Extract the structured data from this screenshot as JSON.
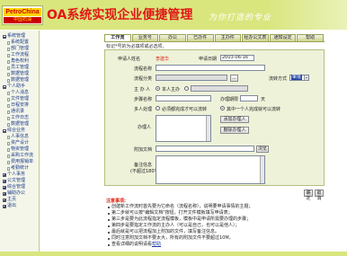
{
  "header": {
    "logo_top": "PetroChina",
    "logo_bottom": "中国石油",
    "title": "OA系统实现企业便捷管理",
    "slogan": "为你打造的专业"
  },
  "sidebar": {
    "items": [
      {
        "label": "系统管理",
        "level": 1,
        "icon": "minus-icon"
      },
      {
        "label": "系统配置",
        "level": 2,
        "icon": "doc-icon"
      },
      {
        "label": "部门管理",
        "level": 2,
        "icon": "doc-icon"
      },
      {
        "label": "工作流程",
        "level": 2,
        "icon": "doc-icon"
      },
      {
        "label": "角色权利",
        "level": 2,
        "icon": "doc-icon"
      },
      {
        "label": "员工管理",
        "level": 2,
        "icon": "doc-icon"
      },
      {
        "label": "数据管理",
        "level": 2,
        "icon": "doc-icon"
      },
      {
        "label": "数据管理",
        "level": 2,
        "icon": "doc-icon"
      },
      {
        "label": "个人助手",
        "level": 1,
        "icon": "minus-icon"
      },
      {
        "label": "个人消息",
        "level": 2,
        "icon": "doc-icon"
      },
      {
        "label": "文件管理",
        "level": 2,
        "icon": "doc-icon"
      },
      {
        "label": "日程安排",
        "level": 2,
        "icon": "doc-icon"
      },
      {
        "label": "通讯录",
        "level": 2,
        "icon": "doc-icon"
      },
      {
        "label": "工作日志",
        "level": 2,
        "icon": "doc-icon"
      },
      {
        "label": "数据管理",
        "level": 2,
        "icon": "doc-icon"
      },
      {
        "label": "综合业务",
        "level": 1,
        "icon": "minus-icon"
      },
      {
        "label": "人事信息",
        "level": 2,
        "icon": "doc-icon"
      },
      {
        "label": "资产设计",
        "level": 2,
        "icon": "doc-icon"
      },
      {
        "label": "物资管理",
        "level": 2,
        "icon": "doc-icon"
      },
      {
        "label": "采购工作流",
        "level": 2,
        "icon": "doc-icon"
      },
      {
        "label": "费用报销单",
        "level": 2,
        "icon": "doc-icon"
      },
      {
        "label": "考勤统计",
        "level": 2,
        "icon": "doc-icon"
      },
      {
        "label": "个人事务",
        "level": 1,
        "icon": "plus-icon"
      },
      {
        "label": "公文管理",
        "level": 1,
        "icon": "plus-icon"
      },
      {
        "label": "综合管理",
        "level": 1,
        "icon": "plus-icon"
      },
      {
        "label": "辅助办公",
        "level": 1,
        "icon": "plus-icon"
      },
      {
        "label": "主页",
        "level": 1,
        "icon": "plus-icon"
      },
      {
        "label": "退出",
        "level": 1,
        "icon": "plus-icon"
      }
    ]
  },
  "tabs": [
    "工作流",
    "业务号",
    "办公",
    "已办件",
    "主办件",
    "经办公文表",
    "通知设定",
    "帮助"
  ],
  "notice": "标记*号的为必填项或必选项。",
  "form": {
    "applicant_label": "申请人姓名",
    "applicant_value": "李建华",
    "date_label": "申请日期",
    "date_value": "2003-06-16",
    "flow_name_label": "流程名称",
    "flow_name_value": "",
    "flow_type_label": "流程分类",
    "flow_type_value": "",
    "flow_type_btn": "...",
    "flow_mode_label": "流转方式",
    "flow_mode_value": "审批",
    "host_label": "主 办 人",
    "host_option1": "本人主办",
    "host_option2": "",
    "step_label": "步骤名称",
    "step_value": "",
    "handle_deadline_label": "办理期限",
    "handle_deadline_unit": "天",
    "multi_label": "多人处理",
    "multi_option1": "必须都完成才可以流转",
    "multi_option2": "其中一个人完成就可以流转",
    "handler_label": "办理人",
    "add_handler_btn": "添加办理人",
    "remove_handler_btn": "删除办理人",
    "attachment_label": "附加文档",
    "attachment_btn": "浏览",
    "note_label": "备注信息",
    "note_hint": "(不超过180字)",
    "submit_btn": "确定",
    "reset_btn": "取消"
  },
  "hints": {
    "title": "注意事项:",
    "items": [
      {
        "text": "创建新工作流时首先要为它命名（流程名称），说明要申请事情的主题；"
      },
      {
        "text": "第二步就可以按\"编辑文档\"按钮，打开文件模板填写申请表；"
      },
      {
        "text": "第三步是要为此流程指定流程模板，模板中是申请所需要办理的步骤；"
      },
      {
        "text": "第四步是要指定工作流的主办人（可以是自己，也可以是他人）；"
      },
      {
        "text": "最后就是可以把流程加上附加的文件，填写备注信息。"
      },
      {
        "text": "同时注意附加文档不要太大，所有的附加文件不要超过10M。"
      },
      {
        "text": "查看详细的说明请看",
        "link": "帮助"
      }
    ]
  }
}
